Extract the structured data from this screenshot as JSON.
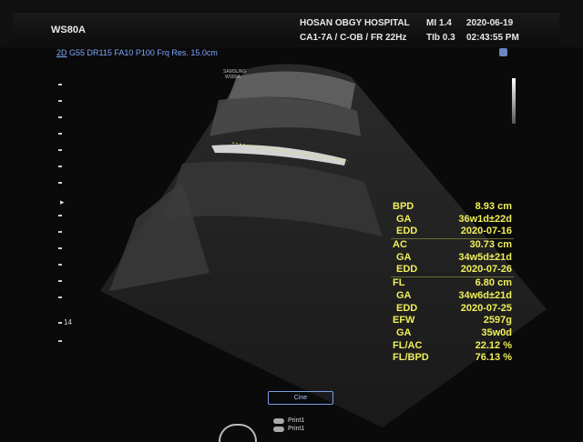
{
  "header": {
    "model": "WS80A",
    "hospital": "HOSAN OBGY HOSPITAL",
    "preset": "CA1-7A / C-OB / FR 22Hz",
    "mi": "MI  1.4",
    "tib": "TIb 0.3",
    "date": "2020-06-19",
    "time": "02:43:55 PM"
  },
  "params": {
    "mode": "2D",
    "rest": " G55 DR115 FA10 P100 Frq Res. 15.0cm"
  },
  "probe_label": "SAMSUNG\nWS80A",
  "depth_label": "14",
  "measurements": [
    {
      "key": "BPD",
      "value": "8.93 cm",
      "indent": false,
      "sep": false
    },
    {
      "key": "GA",
      "value": "36w1d±22d",
      "indent": true,
      "sep": false
    },
    {
      "key": "EDD",
      "value": "2020-07-16",
      "indent": true,
      "sep": false
    },
    {
      "key": "AC",
      "value": "30.73 cm",
      "indent": false,
      "sep": true
    },
    {
      "key": "GA",
      "value": "34w5d±21d",
      "indent": true,
      "sep": false
    },
    {
      "key": "EDD",
      "value": "2020-07-26",
      "indent": true,
      "sep": false
    },
    {
      "key": "FL",
      "value": "6.80 cm",
      "indent": false,
      "sep": true
    },
    {
      "key": "GA",
      "value": "34w6d±21d",
      "indent": true,
      "sep": false
    },
    {
      "key": "EDD",
      "value": "2020-07-25",
      "indent": true,
      "sep": false
    },
    {
      "key": "EFW",
      "value": "2597g",
      "indent": false,
      "sep": false
    },
    {
      "key": "GA",
      "value": "35w0d",
      "indent": true,
      "sep": false
    },
    {
      "key": "FL/AC",
      "value": "22.12 %",
      "indent": false,
      "sep": false
    },
    {
      "key": "FL/BPD",
      "value": "76.13 %",
      "indent": false,
      "sep": false
    }
  ],
  "cine_label": "Cine",
  "print1_label": "Print1",
  "print2_label": "Print1"
}
